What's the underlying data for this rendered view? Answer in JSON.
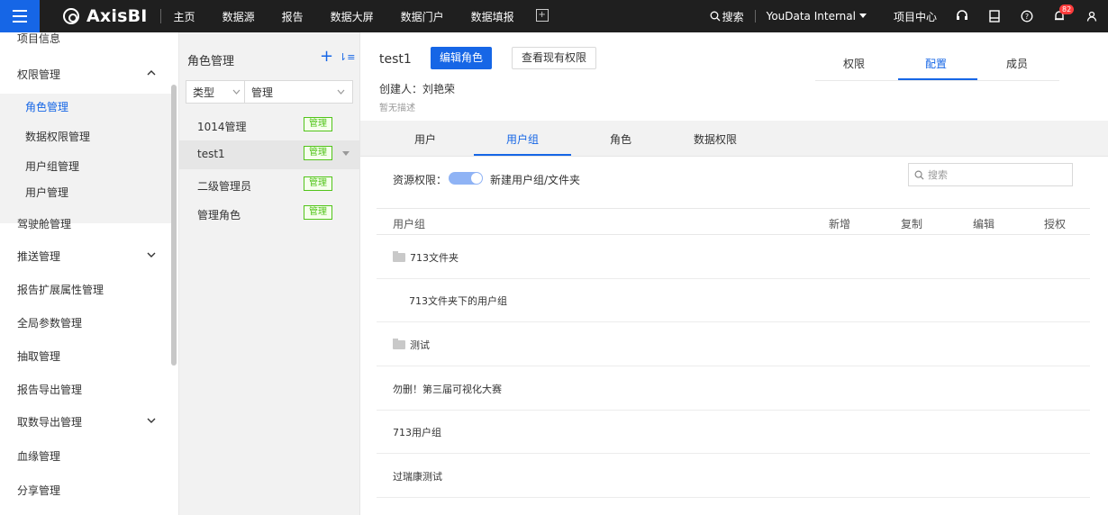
{
  "app": {
    "logo_text": "AxisBI",
    "nav": [
      "主页",
      "数据源",
      "报告",
      "数据大屏",
      "数据门户",
      "数据填报"
    ],
    "search_label": "搜索",
    "org_name": "YouData Internal",
    "project_center": "项目中心",
    "notification_count": "82"
  },
  "sidebar": {
    "top_cut": "项目信息",
    "group": "权限管理",
    "sub_items": [
      "角色管理",
      "数据权限管理",
      "用户组管理",
      "用户管理"
    ],
    "items": [
      "驾驶舱管理",
      "推送管理",
      "报告扩展属性管理",
      "全局参数管理",
      "抽取管理",
      "报告导出管理",
      "取数导出管理",
      "血缘管理",
      "分享管理"
    ]
  },
  "role_panel": {
    "title": "角色管理",
    "filter_type": "类型",
    "filter_value": "管理",
    "roles": [
      {
        "name": "1014管理",
        "tag": "管理"
      },
      {
        "name": "test1",
        "tag": "管理"
      },
      {
        "name": "二级管理员",
        "tag": "管理"
      },
      {
        "name": "管理角色",
        "tag": "管理"
      }
    ]
  },
  "detail": {
    "role_name": "test1",
    "edit_button": "编辑角色",
    "view_button": "查看现有权限",
    "creator": "创建人：刘艳荣",
    "description": "暂无描述",
    "top_tabs": [
      "权限",
      "配置",
      "成员"
    ],
    "active_top_tab": "配置",
    "sub_tabs": [
      "用户",
      "用户组",
      "角色",
      "数据权限"
    ],
    "active_sub_tab": "用户组",
    "resource_label": "资源权限：",
    "resource_toggle_on": true,
    "resource_text": "新建用户组/文件夹",
    "search_placeholder": "搜索",
    "columns": [
      "用户组",
      "新增",
      "复制",
      "编辑",
      "授权"
    ],
    "rows": [
      {
        "name": "713文件夹",
        "folder": true
      },
      {
        "name": "713文件夹下的用户组",
        "folder": false,
        "indent": true
      },
      {
        "name": "测试",
        "folder": true
      },
      {
        "name": "勿删！第三届可视化大赛",
        "folder": false
      },
      {
        "name": "713用户组",
        "folder": false
      },
      {
        "name": "过瑞康测试",
        "folder": false
      }
    ]
  },
  "colors": {
    "primary": "#1666e6",
    "topbar": "#1f1f1f",
    "tag_green": "#52c41a",
    "badge_red": "#ff3b3b"
  }
}
